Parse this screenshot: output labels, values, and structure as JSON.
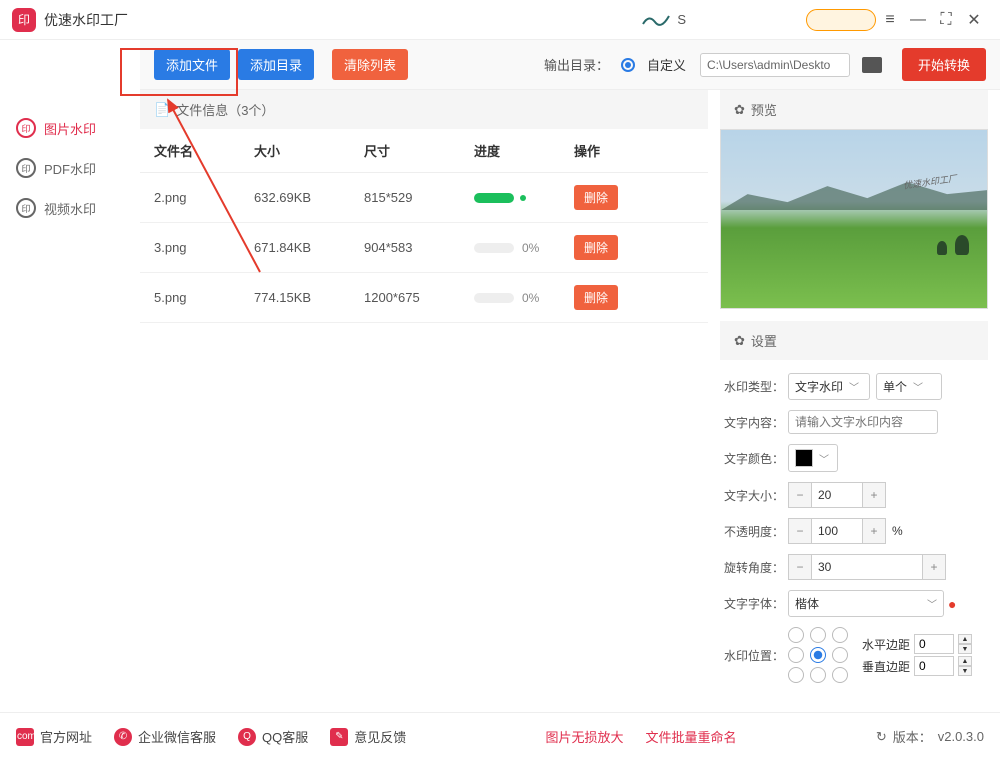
{
  "app": {
    "title": "优速水印工厂"
  },
  "titlebar": {
    "scribble": "S"
  },
  "toolbar": {
    "add_file": "添加文件",
    "add_dir": "添加目录",
    "clear": "清除列表",
    "output_label": "输出目录：",
    "output_mode": "自定义",
    "output_path": "C:\\Users\\admin\\Deskto",
    "start": "开始转换"
  },
  "sidebar": {
    "items": [
      {
        "label": "图片水印"
      },
      {
        "label": "PDF水印"
      },
      {
        "label": "视频水印"
      }
    ]
  },
  "fileinfo": {
    "header": "文件信息（3个）",
    "cols": {
      "name": "文件名",
      "size": "大小",
      "dim": "尺寸",
      "prog": "进度",
      "op": "操作"
    },
    "delete": "删除",
    "rows": [
      {
        "name": "2.png",
        "size": "632.69KB",
        "dim": "815*529",
        "prog": "",
        "done": true
      },
      {
        "name": "3.png",
        "size": "671.84KB",
        "dim": "904*583",
        "prog": "0%",
        "done": false
      },
      {
        "name": "5.png",
        "size": "774.15KB",
        "dim": "1200*675",
        "prog": "0%",
        "done": false
      }
    ]
  },
  "preview": {
    "title": "预览",
    "watermark_sample": "优速水印工厂"
  },
  "settings": {
    "title": "设置",
    "type_label": "水印类型：",
    "type_val": "文字水印",
    "type_mode": "单个",
    "content_label": "文字内容：",
    "content_ph": "请输入文字水印内容",
    "color_label": "文字颜色：",
    "color_val": "#000000",
    "size_label": "文字大小：",
    "size_val": "20",
    "opacity_label": "不透明度：",
    "opacity_val": "100",
    "opacity_unit": "%",
    "rotate_label": "旋转角度：",
    "rotate_val": "30",
    "font_label": "文字字体：",
    "font_val": "楷体",
    "pos_label": "水印位置：",
    "hmargin_label": "水平边距",
    "hmargin_val": "0",
    "vmargin_label": "垂直边距",
    "vmargin_val": "0"
  },
  "footer": {
    "site": "官方网址",
    "wechat": "企业微信客服",
    "qq": "QQ客服",
    "feedback": "意见反馈",
    "enlarge": "图片无损放大",
    "rename": "文件批量重命名",
    "version_label": "版本：",
    "version": "v2.0.3.0"
  }
}
